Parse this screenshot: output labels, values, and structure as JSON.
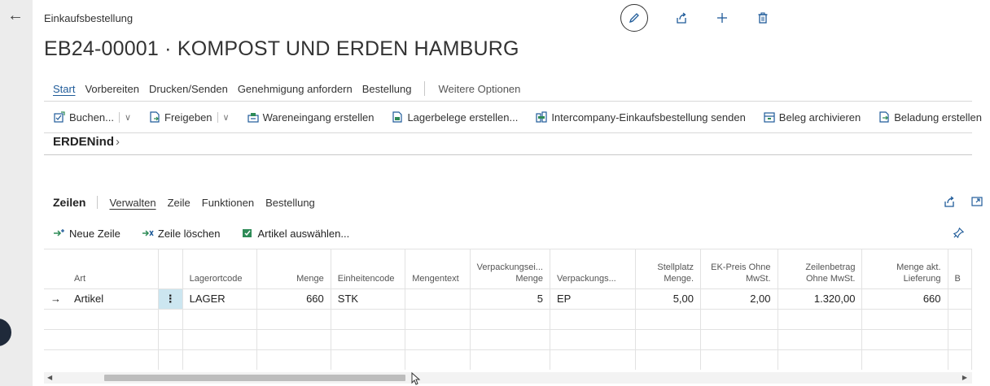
{
  "header": {
    "breadcrumb": "Einkaufsbestellung",
    "title": "EB24-00001 · KOMPOST UND ERDEN HAMBURG"
  },
  "top_actions": {
    "icons": [
      "edit-pencil-icon",
      "share-icon",
      "plus-icon",
      "trash-icon"
    ]
  },
  "action_tabs": [
    {
      "label": "Start",
      "active": true
    },
    {
      "label": "Vorbereiten"
    },
    {
      "label": "Drucken/Senden"
    },
    {
      "label": "Genehmigung anfordern"
    },
    {
      "label": "Bestellung"
    }
  ],
  "action_more": "Weitere Optionen",
  "toolbar": {
    "buchen": "Buchen...",
    "freigeben": "Freigeben",
    "wareneingang": "Wareneingang erstellen",
    "lagerbelege": "Lagerbelege erstellen...",
    "intercompany": "Intercompany-Einkaufsbestellung senden",
    "archivieren": "Beleg archivieren",
    "beladung": "Beladung erstellen"
  },
  "factbox_link": "ERDENind",
  "lines": {
    "title": "Zeilen",
    "tabs": [
      {
        "label": "Verwalten",
        "active": true
      },
      {
        "label": "Zeile"
      },
      {
        "label": "Funktionen"
      },
      {
        "label": "Bestellung"
      }
    ],
    "new_line": "Neue Zeile",
    "delete_line": "Zeile löschen",
    "select_items": "Artikel auswählen..."
  },
  "grid": {
    "columns": {
      "art": "Art",
      "lagerortcode": "Lagerortcode",
      "menge": "Menge",
      "einheitencode": "Einheitencode",
      "mengentext": "Mengentext",
      "verpackungsei_1": "Verpackungsei...",
      "verpackungsei_2": "Menge",
      "verpackungs": "Verpackungs...",
      "stellplatz_1": "Stellplatz",
      "stellplatz_2": "Menge.",
      "ekpreis_1": "EK-Preis Ohne",
      "ekpreis_2": "MwSt.",
      "zeilenbetrag_1": "Zeilenbetrag",
      "zeilenbetrag_2": "Ohne MwSt.",
      "mengeakt_1": "Menge akt.",
      "mengeakt_2": "Lieferung",
      "b": "B"
    },
    "row1": {
      "arrow": "→",
      "art": "Artikel",
      "dots": "⋮",
      "lagerortcode": "LAGER",
      "menge": "660",
      "einheitencode": "STK",
      "mengentext": "",
      "verpackungseinheit": "5",
      "verpackungsart": "EP",
      "stellplatz": "5,00",
      "ekpreis": "2,00",
      "zeilenbetrag": "1.320,00",
      "menge_akt": "660"
    }
  },
  "colors": {
    "accent": "#1f5b99",
    "selected_cell": "#cce6f0",
    "brand_green": "#2e8b57"
  }
}
